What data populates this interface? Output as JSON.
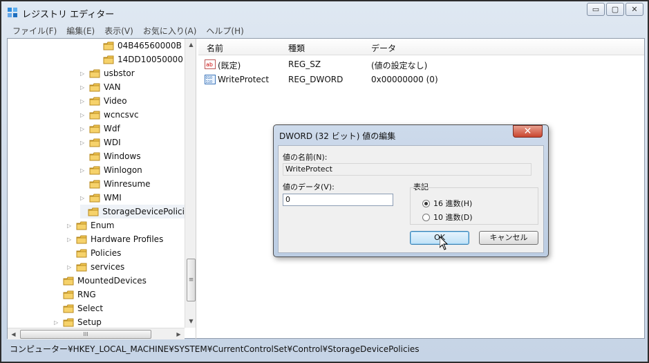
{
  "window": {
    "title": "レジストリ エディター",
    "controls": [
      "▭",
      "▢",
      "✕"
    ]
  },
  "menu": [
    "ファイル(F)",
    "編集(E)",
    "表示(V)",
    "お気に入り(A)",
    "ヘルプ(H)"
  ],
  "tree": [
    {
      "label": "04B46560000B",
      "expand": "",
      "level": 2
    },
    {
      "label": "14DD10050000",
      "expand": "",
      "level": 2
    },
    {
      "label": "usbstor",
      "expand": "▷",
      "level": 1
    },
    {
      "label": "VAN",
      "expand": "▷",
      "level": 1
    },
    {
      "label": "Video",
      "expand": "▷",
      "level": 1
    },
    {
      "label": "wcncsvc",
      "expand": "▷",
      "level": 1
    },
    {
      "label": "Wdf",
      "expand": "▷",
      "level": 1
    },
    {
      "label": "WDI",
      "expand": "▷",
      "level": 1
    },
    {
      "label": "Windows",
      "expand": "",
      "level": 1
    },
    {
      "label": "Winlogon",
      "expand": "▷",
      "level": 1
    },
    {
      "label": "Winresume",
      "expand": "",
      "level": 1
    },
    {
      "label": "WMI",
      "expand": "▷",
      "level": 1
    },
    {
      "label": "StorageDevicePolici",
      "expand": "",
      "level": 1,
      "selected": true
    },
    {
      "label": "Enum",
      "expand": "▷",
      "level": 0
    },
    {
      "label": "Hardware Profiles",
      "expand": "▷",
      "level": 0
    },
    {
      "label": "Policies",
      "expand": "",
      "level": 0
    },
    {
      "label": "services",
      "expand": "▷",
      "level": 0
    },
    {
      "label": "MountedDevices",
      "expand": "",
      "level": -1
    },
    {
      "label": "RNG",
      "expand": "",
      "level": -1
    },
    {
      "label": "Select",
      "expand": "",
      "level": -1
    },
    {
      "label": "Setup",
      "expand": "▷",
      "level": -1
    }
  ],
  "list": {
    "headers": [
      "名前",
      "種類",
      "データ"
    ],
    "rows": [
      {
        "name": "(既定)",
        "type": "REG_SZ",
        "data": "(値の設定なし)",
        "icon": "string-value-icon"
      },
      {
        "name": "WriteProtect",
        "type": "REG_DWORD",
        "data": "0x00000000 (0)",
        "icon": "dword-value-icon"
      }
    ]
  },
  "status": "コンピューター¥HKEY_LOCAL_MACHINE¥SYSTEM¥CurrentControlSet¥Control¥StorageDevicePolicies",
  "dialog": {
    "title": "DWORD (32 ビット) 値の編集",
    "close": "✕",
    "value_name_label": "値の名前(N):",
    "value_name": "WriteProtect",
    "value_data_label": "値のデータ(V):",
    "value_data": "0",
    "base_label": "表記",
    "radio_hex": "16 進数(H)",
    "radio_dec": "10 進数(D)",
    "ok": "OK",
    "cancel": "キャンセル"
  },
  "scroll": {
    "grip": "≡",
    "h_grip": "III"
  }
}
